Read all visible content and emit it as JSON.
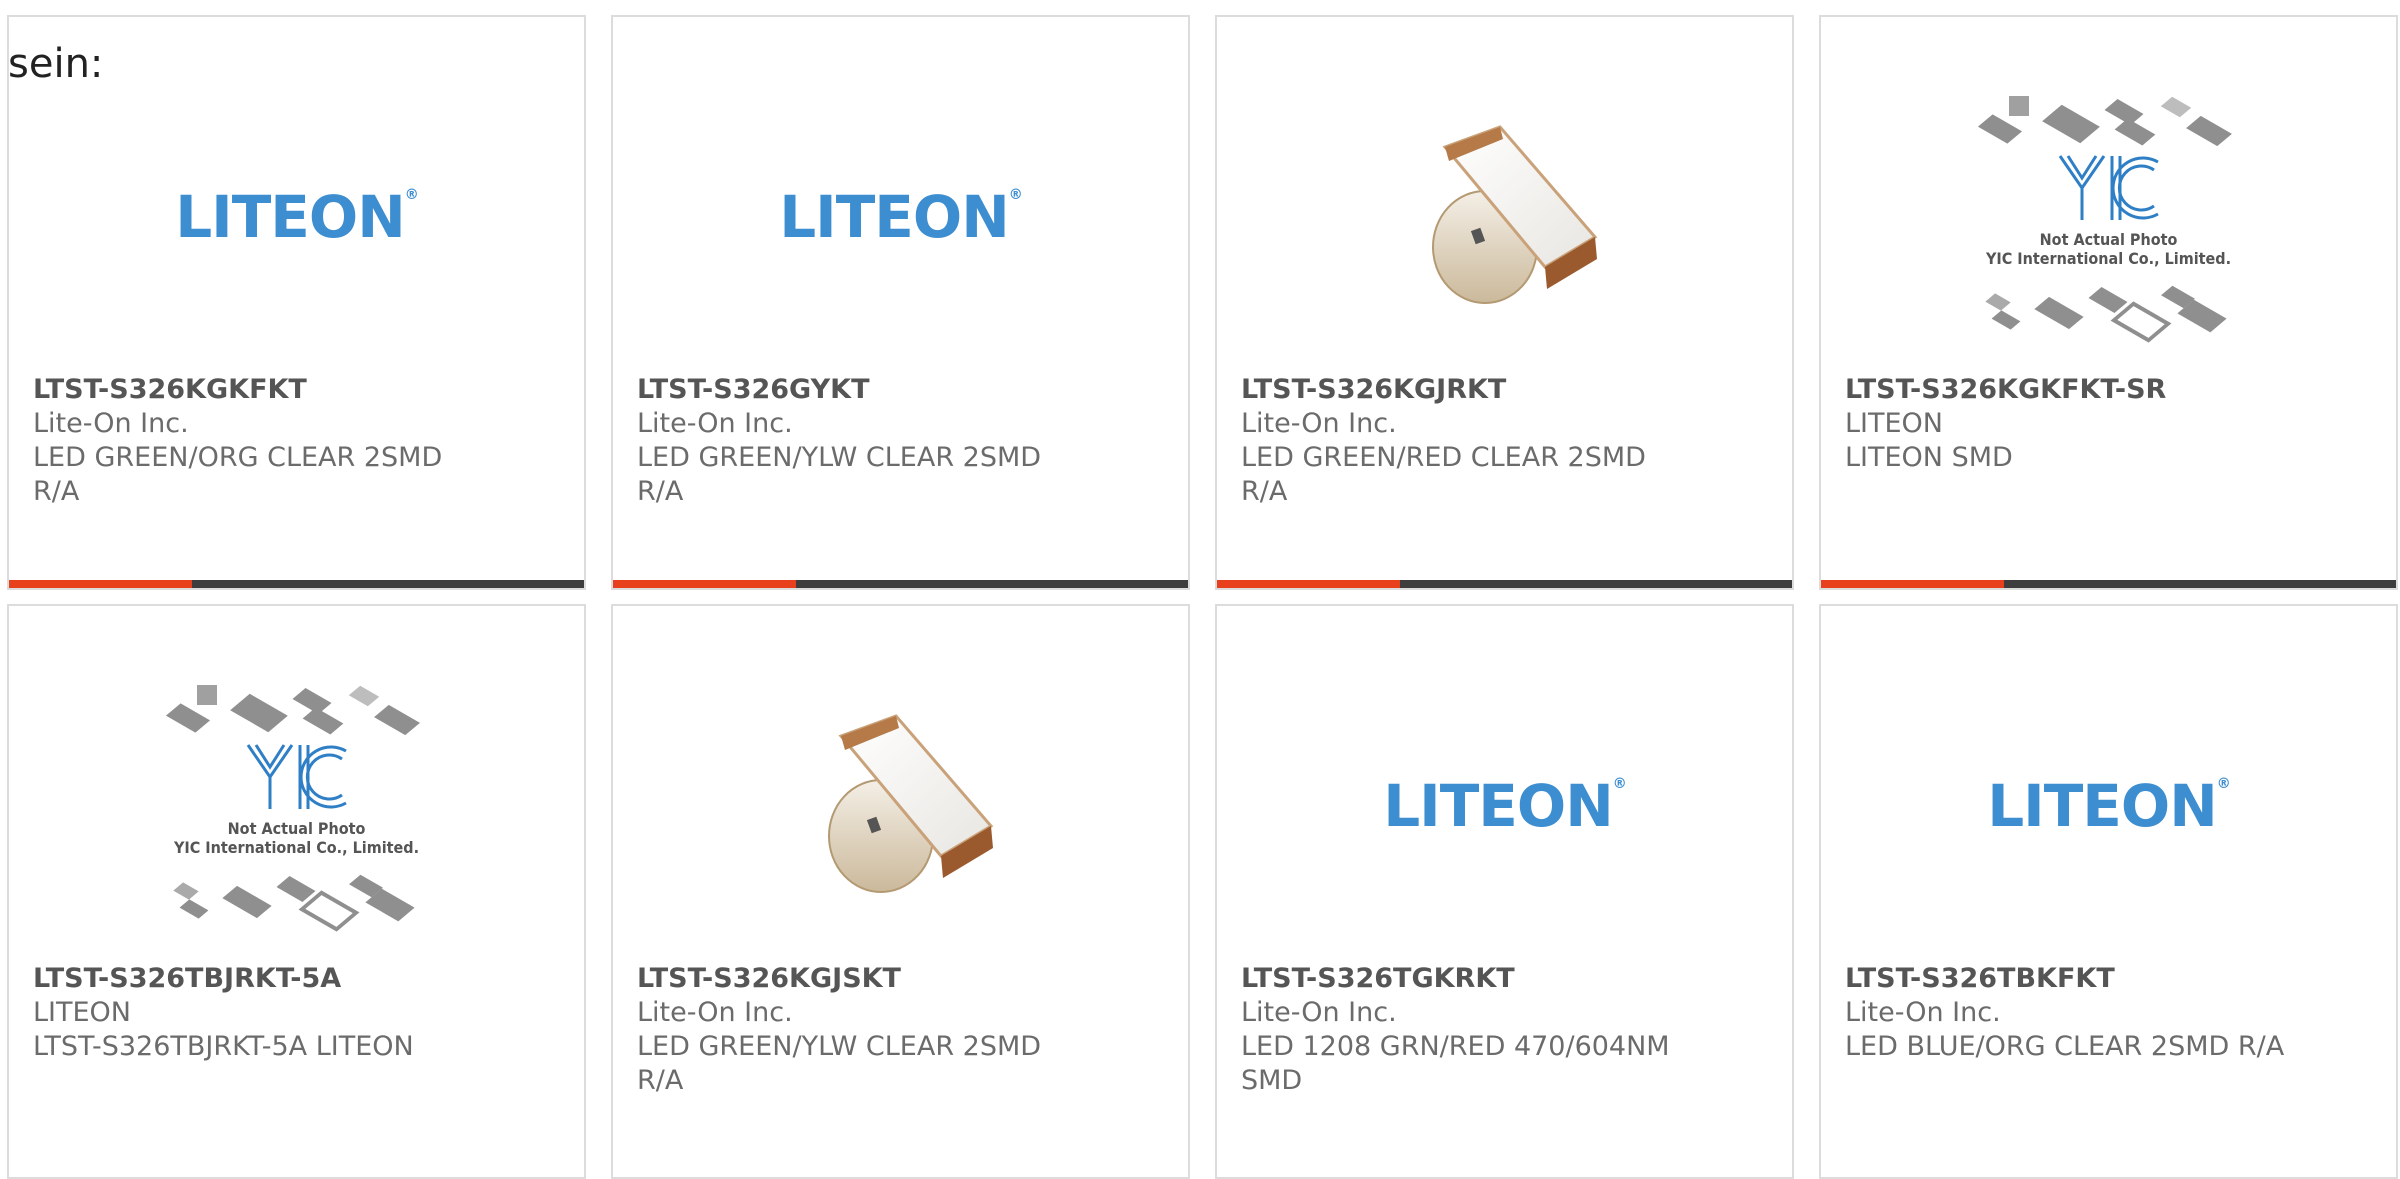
{
  "intro_text": "sein:",
  "colors": {
    "accent": "#e8401c",
    "bar": "#3d3d3d",
    "liteon_blue": "#3d8ed1",
    "text": "#6b6b6b"
  },
  "logos": {
    "liteon": "LITEON",
    "yic_note_1": "Not Actual Photo",
    "yic_note_2": "YIC International Co., Limited."
  },
  "products": [
    {
      "pn": "LTST-S326KGKFKT",
      "mfr": "Lite-On Inc.",
      "desc": [
        "LED GREEN/ORG CLEAR 2SMD",
        "R/A"
      ],
      "image": "liteon-logo",
      "accent": true
    },
    {
      "pn": "LTST-S326GYKT",
      "mfr": "Lite-On Inc.",
      "desc": [
        "LED GREEN/YLW CLEAR 2SMD",
        "R/A"
      ],
      "image": "liteon-logo",
      "accent": true
    },
    {
      "pn": "LTST-S326KGJRKT",
      "mfr": "Lite-On Inc.",
      "desc": [
        "LED GREEN/RED CLEAR 2SMD",
        "R/A"
      ],
      "image": "led-photo",
      "accent": true
    },
    {
      "pn": "LTST-S326KGKFKT-SR",
      "mfr": "LITEON",
      "desc": [
        "LITEON SMD",
        ""
      ],
      "image": "yic-placeholder",
      "accent": true
    },
    {
      "pn": "LTST-S326TBJRKT-5A",
      "mfr": "LITEON",
      "desc": [
        "LTST-S326TBJRKT-5A LITEON",
        ""
      ],
      "image": "yic-placeholder",
      "accent": false
    },
    {
      "pn": "LTST-S326KGJSKT",
      "mfr": "Lite-On Inc.",
      "desc": [
        "LED GREEN/YLW CLEAR 2SMD",
        "R/A"
      ],
      "image": "led-photo",
      "accent": false
    },
    {
      "pn": "LTST-S326TGKRKT",
      "mfr": "Lite-On Inc.",
      "desc": [
        "LED 1208 GRN/RED 470/604NM",
        "SMD"
      ],
      "image": "liteon-logo",
      "accent": false
    },
    {
      "pn": "LTST-S326TBKFKT",
      "mfr": "Lite-On Inc.",
      "desc": [
        "LED BLUE/ORG CLEAR 2SMD R/A",
        ""
      ],
      "image": "liteon-logo",
      "accent": false
    }
  ]
}
